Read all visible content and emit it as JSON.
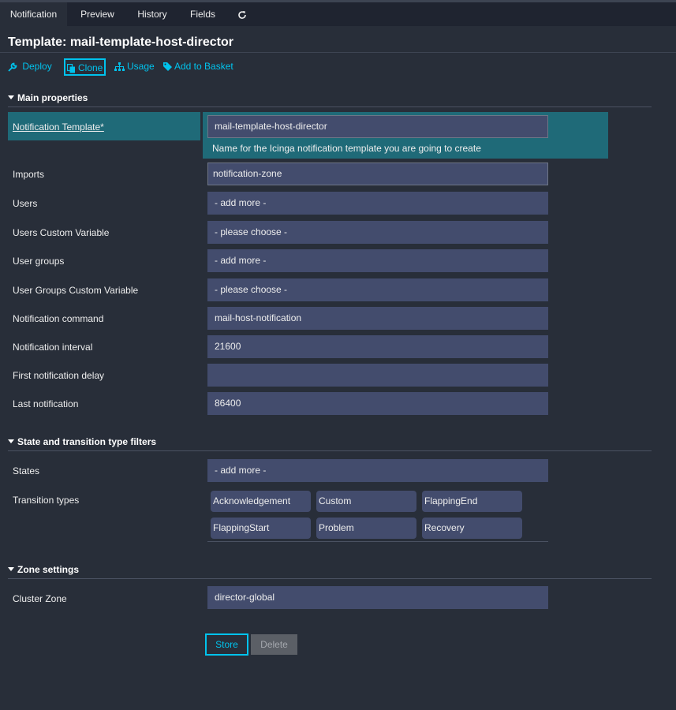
{
  "tabs": [
    {
      "label": "Notification",
      "active": true
    },
    {
      "label": "Preview"
    },
    {
      "label": "History"
    },
    {
      "label": "Fields"
    }
  ],
  "refresh_icon": "refresh-icon",
  "title": "Template: mail-template-host-director",
  "actions": {
    "deploy": "Deploy",
    "clone": "Clone",
    "usage": "Usage",
    "add_to_basket": "Add to Basket"
  },
  "sections": {
    "main": "Main properties",
    "state": "State and transition type filters",
    "zone": "Zone settings"
  },
  "main": {
    "template_label": "Notification Template*",
    "template_value": "mail-template-host-director",
    "template_hint": "Name for the Icinga notification template you are going to create",
    "fields": [
      {
        "label": "Imports",
        "value": "notification-zone"
      },
      {
        "label": "Users",
        "value": "- add more -"
      },
      {
        "label": "Users Custom Variable",
        "value": "- please choose -"
      },
      {
        "label": "User groups",
        "value": "- add more -"
      },
      {
        "label": "User Groups Custom Variable",
        "value": "- please choose -"
      },
      {
        "label": "Notification command",
        "value": "mail-host-notification"
      },
      {
        "label": "Notification interval",
        "value": "21600"
      },
      {
        "label": "First notification delay",
        "value": ""
      },
      {
        "label": "Last notification",
        "value": "86400"
      }
    ]
  },
  "state": {
    "states_label": "States",
    "states_value": "- add more -",
    "transition_label": "Transition types",
    "transition_types": [
      "Acknowledgement",
      "Custom",
      "FlappingEnd",
      "FlappingStart",
      "Problem",
      "Recovery"
    ]
  },
  "zone": {
    "cluster_label": "Cluster Zone",
    "cluster_value": "director-global"
  },
  "buttons": {
    "store": "Store",
    "delete": "Delete"
  },
  "colors": {
    "background": "#282e39",
    "accent": "#00c3ed",
    "highlight": "#1f6a78",
    "field": "#434c6d"
  }
}
